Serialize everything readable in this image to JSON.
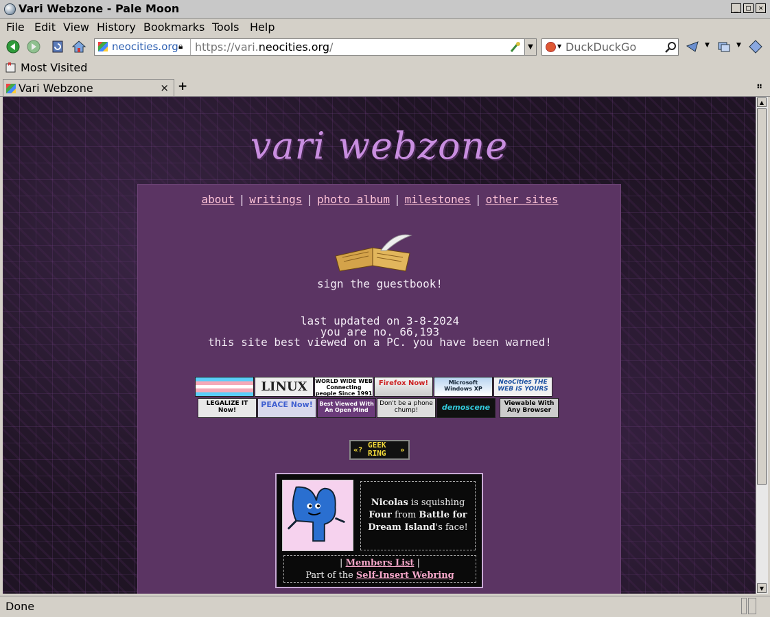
{
  "window": {
    "title": "Vari Webzone - Pale Moon",
    "min": "_",
    "max": "□",
    "close": "×"
  },
  "menu": [
    "File",
    "Edit",
    "View",
    "History",
    "Bookmarks",
    "Tools",
    "Help"
  ],
  "navbar": {
    "site_domain": "neocities.org",
    "url_prefix": "https://vari.",
    "url_domain": "neocities.org",
    "url_suffix": "/",
    "search_placeholder": "DuckDuckGo"
  },
  "bookmarks": {
    "most_visited": "Most Visited"
  },
  "tab": {
    "title": "Vari Webzone",
    "close": "×",
    "new": "+"
  },
  "page": {
    "site_title": "vari webzone",
    "nav": [
      "about",
      "writings",
      "photo album",
      "milestones",
      "other sites"
    ],
    "guestbook": "sign the guestbook!",
    "last_updated": "last updated on 3-8-2024",
    "visitor": "you are no. 66,193",
    "warning": "this site best viewed on a PC. you have been warned!",
    "buttons_row1": [
      "",
      "LINUX",
      "WORLD WIDE WEB Connecting people Since 1991",
      "Firefox Now!",
      "Microsoft Windows XP",
      "NeoCities THE WEB IS YOURS"
    ],
    "buttons_row2": [
      "LEGALIZE IT Now!",
      "PEACE Now!",
      "Best Viewed With An Open Mind",
      "Don't be a phone chump!",
      "demoscene",
      "Viewable With Any Browser"
    ],
    "geekring": {
      "left": "«?",
      "text1": "GEEK",
      "text2": "RING",
      "right": "»"
    },
    "webring": {
      "name": "Nicolas",
      "line1_mid": " is squishing",
      "four": "Four",
      "from": " from ",
      "bfdi1": "Battle for",
      "bfdi2": "Dream Island",
      "face": "'s face!",
      "members_pre": "| ",
      "members": "Members List",
      "members_post": " |",
      "part_of": "Part of the ",
      "ring": "Self-Insert Webring"
    }
  },
  "status": "Done",
  "colors": {
    "panel": "#5b3463",
    "title": "#c98ee0",
    "link": "#ffc4d8"
  }
}
